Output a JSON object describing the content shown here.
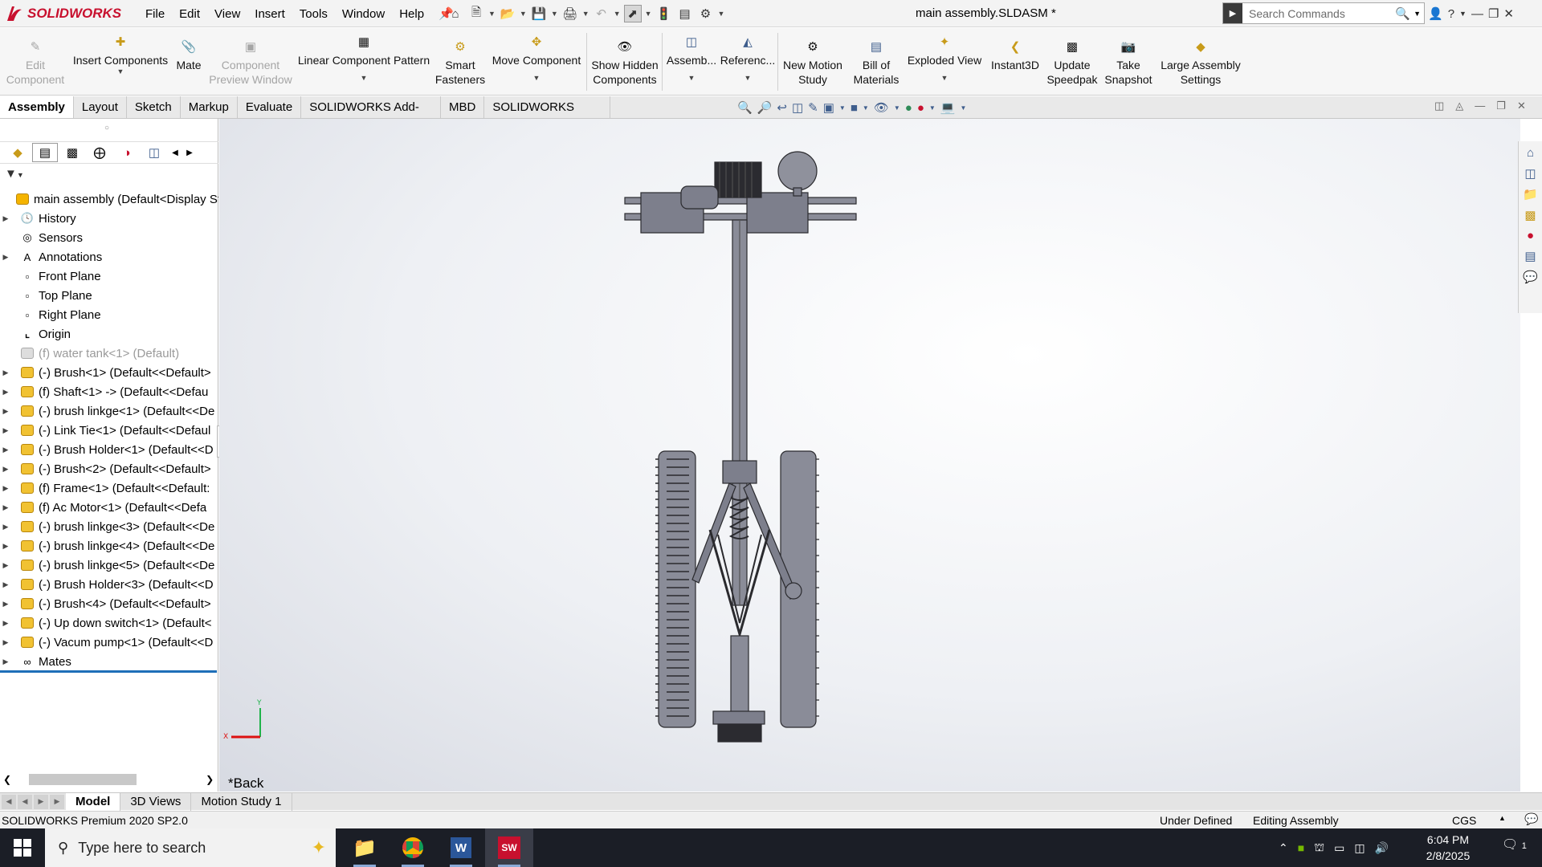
{
  "app": {
    "logo_text": "SOLIDWORKS",
    "document_title": "main assembly.SLDASM *",
    "brand_color": "#c8102e"
  },
  "menu": [
    "File",
    "Edit",
    "View",
    "Insert",
    "Tools",
    "Window",
    "Help"
  ],
  "search": {
    "placeholder": "Search Commands"
  },
  "ribbon": {
    "edit_component": "Edit Component",
    "insert_components": "Insert Components",
    "mate": "Mate",
    "component_preview": "Component Preview Window",
    "linear_pattern": "Linear Component Pattern",
    "smart_fasteners": "Smart Fasteners",
    "move_component": "Move Component",
    "show_hidden": "Show Hidden Components",
    "assembly": "Assemb...",
    "reference": "Referenc...",
    "new_motion_study": "New Motion Study",
    "bill_of_materials": "Bill of Materials",
    "exploded_view": "Exploded View",
    "instant3d": "Instant3D",
    "update_speedpak": "Update Speedpak",
    "take_snapshot": "Take Snapshot",
    "large_assembly": "Large Assembly Settings"
  },
  "command_tabs": [
    "Assembly",
    "Layout",
    "Sketch",
    "Markup",
    "Evaluate",
    "SOLIDWORKS Add-Ins",
    "MBD",
    "SOLIDWORKS CAM"
  ],
  "tree": {
    "root": "main assembly  (Default<Display Sta",
    "items": [
      {
        "label": "History",
        "icon": "history-icon",
        "expand": true,
        "kind": "folder"
      },
      {
        "label": "Sensors",
        "icon": "sensors-icon",
        "expand": false,
        "kind": "folder"
      },
      {
        "label": "Annotations",
        "icon": "annotations-icon",
        "expand": true,
        "kind": "folder"
      },
      {
        "label": "Front Plane",
        "icon": "plane-icon",
        "expand": false,
        "kind": "plane"
      },
      {
        "label": "Top Plane",
        "icon": "plane-icon",
        "expand": false,
        "kind": "plane"
      },
      {
        "label": "Right Plane",
        "icon": "plane-icon",
        "expand": false,
        "kind": "plane"
      },
      {
        "label": "Origin",
        "icon": "origin-icon",
        "expand": false,
        "kind": "origin"
      },
      {
        "label": "(f) water tank<1> (Default)",
        "icon": "part-icon",
        "expand": false,
        "kind": "suppressed"
      },
      {
        "label": "(-) Brush<1> (Default<<Default>",
        "icon": "part-icon",
        "expand": true,
        "kind": "part"
      },
      {
        "label": "(f) Shaft<1> -> (Default<<Defau",
        "icon": "part-icon",
        "expand": true,
        "kind": "part"
      },
      {
        "label": "(-) brush linkge<1> (Default<<De",
        "icon": "part-icon",
        "expand": true,
        "kind": "part"
      },
      {
        "label": "(-) Link Tie<1> (Default<<Defaul",
        "icon": "part-icon",
        "expand": true,
        "kind": "part"
      },
      {
        "label": "(-) Brush Holder<1> (Default<<D",
        "icon": "part-icon",
        "expand": true,
        "kind": "part"
      },
      {
        "label": "(-) Brush<2> (Default<<Default>",
        "icon": "part-icon",
        "expand": true,
        "kind": "part"
      },
      {
        "label": "(f) Frame<1> (Default<<Default:",
        "icon": "part-icon",
        "expand": true,
        "kind": "part"
      },
      {
        "label": "(f) Ac Motor<1> (Default<<Defa",
        "icon": "part-icon",
        "expand": true,
        "kind": "part"
      },
      {
        "label": "(-) brush linkge<3> (Default<<De",
        "icon": "part-icon",
        "expand": true,
        "kind": "part"
      },
      {
        "label": "(-) brush linkge<4> (Default<<De",
        "icon": "part-icon",
        "expand": true,
        "kind": "part"
      },
      {
        "label": "(-) brush linkge<5> (Default<<De",
        "icon": "part-icon",
        "expand": true,
        "kind": "part"
      },
      {
        "label": "(-) Brush Holder<3> (Default<<D",
        "icon": "part-icon",
        "expand": true,
        "kind": "part"
      },
      {
        "label": "(-) Brush<4> (Default<<Default>",
        "icon": "part-icon",
        "expand": true,
        "kind": "part"
      },
      {
        "label": "(-) Up down switch<1> (Default<",
        "icon": "part-icon",
        "expand": true,
        "kind": "part"
      },
      {
        "label": "(-) Vacum pump<1> (Default<<D",
        "icon": "part-icon",
        "expand": true,
        "kind": "part"
      },
      {
        "label": "Mates",
        "icon": "mates-icon",
        "expand": true,
        "kind": "folder"
      }
    ]
  },
  "viewport": {
    "view_label": "*Back",
    "triad_x": "X",
    "triad_y": "Y"
  },
  "bottom_tabs": [
    "Model",
    "3D Views",
    "Motion Study 1"
  ],
  "status": {
    "product": "SOLIDWORKS Premium 2020 SP2.0",
    "state": "Under Defined",
    "mode": "Editing Assembly",
    "units": "CGS"
  },
  "taskbar": {
    "search_placeholder": "Type here to search",
    "time": "6:04 PM",
    "date": "2/8/2025",
    "notifications": "1"
  }
}
